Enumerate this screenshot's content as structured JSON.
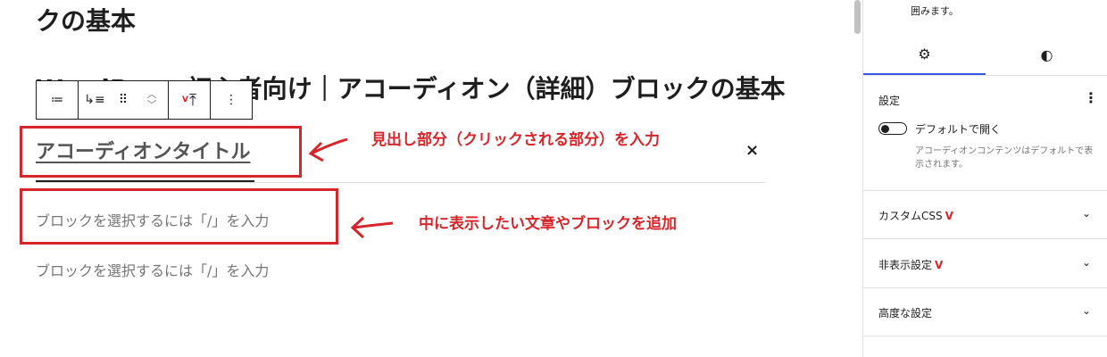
{
  "editor": {
    "heading_top": "クの基本",
    "heading_main": "WordPress初心者向け｜アコーディオン（詳細）ブロックの基本",
    "accordion_title": "アコーディオンタイトル",
    "close_icon": "×",
    "placeholder_1": "ブロックを選択するには「/」を入力",
    "placeholder_2": "ブロックを選択するには「/」を入力",
    "annotation_1": "見出し部分（クリックされる部分）を入力",
    "annotation_2": "中に表示したい文章やブロックを追加",
    "annotation_color": "#d6262c"
  },
  "toolbar": {
    "list_view_icon": "≔",
    "block_type_icon": "↳≡",
    "drag_icon": "⠿",
    "move_up_icon": "︿",
    "move_down_icon": "﹀",
    "vk_height_icon": "⤒",
    "more_icon": "⋮"
  },
  "sidebar": {
    "top_text": "囲みます。",
    "tab_settings_icon": "⚙",
    "tab_styles_icon": "◐",
    "settings_title": "設定",
    "toggle_label": "デフォルトで開く",
    "toggle_help": "アコーディオンコンテンツはデフォルトで表示されます。",
    "custom_css": "カスタムCSS",
    "hide_settings": "非表示設定",
    "advanced": "高度な設定",
    "vk_badge": "V",
    "chevron": "⌄",
    "accent_color": "#3858e9"
  }
}
